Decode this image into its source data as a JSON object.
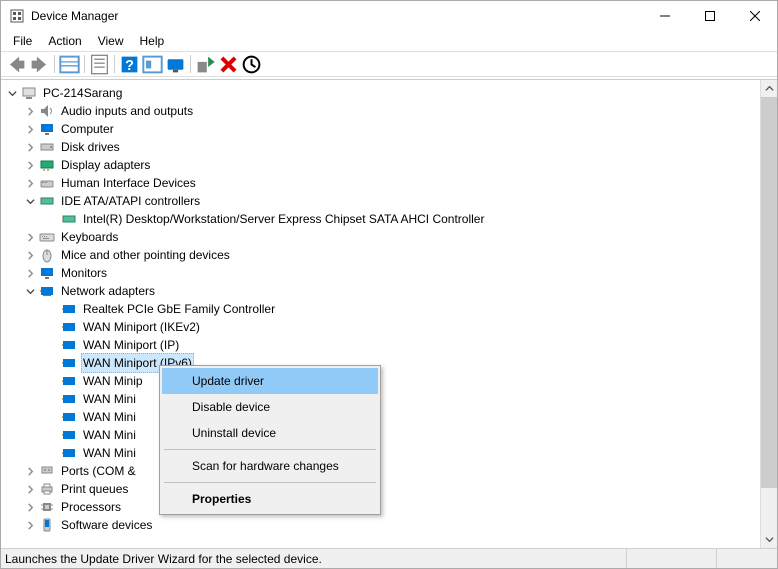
{
  "window": {
    "title": "Device Manager"
  },
  "menu": {
    "file": "File",
    "action": "Action",
    "view": "View",
    "help": "Help"
  },
  "tree": {
    "root": "PC-214Sarang",
    "audio": "Audio inputs and outputs",
    "computer": "Computer",
    "disk": "Disk drives",
    "display": "Display adapters",
    "hid": "Human Interface Devices",
    "ide": "IDE ATA/ATAPI controllers",
    "ide_child": "Intel(R) Desktop/Workstation/Server Express Chipset SATA AHCI Controller",
    "keyboards": "Keyboards",
    "mice": "Mice and other pointing devices",
    "monitors": "Monitors",
    "network": "Network adapters",
    "net_items": [
      "Realtek PCIe GbE Family Controller",
      "WAN Miniport (IKEv2)",
      "WAN Miniport (IP)",
      "WAN Miniport (IPv6)",
      "WAN Minip",
      "WAN Mini",
      "WAN Mini",
      "WAN Mini",
      "WAN Mini"
    ],
    "ports": "Ports (COM &",
    "printq": "Print queues",
    "processors": "Processors",
    "software": "Software devices"
  },
  "context_menu": {
    "update": "Update driver",
    "disable": "Disable device",
    "uninstall": "Uninstall device",
    "scan": "Scan for hardware changes",
    "properties": "Properties"
  },
  "status": {
    "text": "Launches the Update Driver Wizard for the selected device."
  }
}
